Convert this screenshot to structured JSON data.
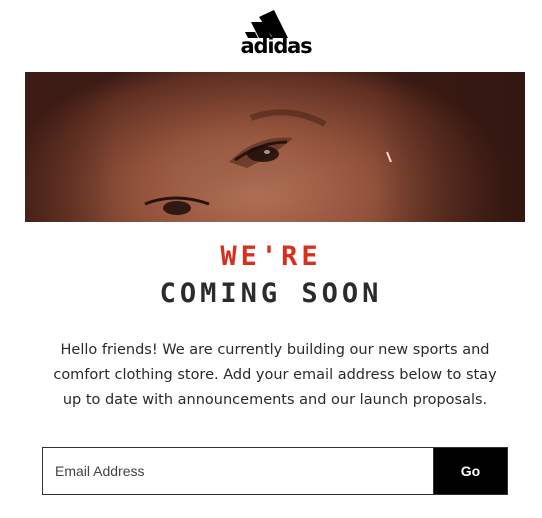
{
  "brand": {
    "name": "adidas",
    "logo_icon": "adidas-performance-stripes-icon",
    "color": "#000000"
  },
  "hero": {
    "image": "model-face-closeup-photo"
  },
  "headline": {
    "line1": "WE'RE",
    "line2": "COMING SOON",
    "accent_color": "#d9301e",
    "text_color": "#2b2b2b"
  },
  "intro_text": "Hello friends! We are currently building our new sports and comfort clothing store. Add your email address below to stay up to date with announcements and our launch proposals.",
  "subscribe": {
    "email_placeholder": "Email Address",
    "email_value": "",
    "submit_label": "Go",
    "button_color": "#000000"
  }
}
